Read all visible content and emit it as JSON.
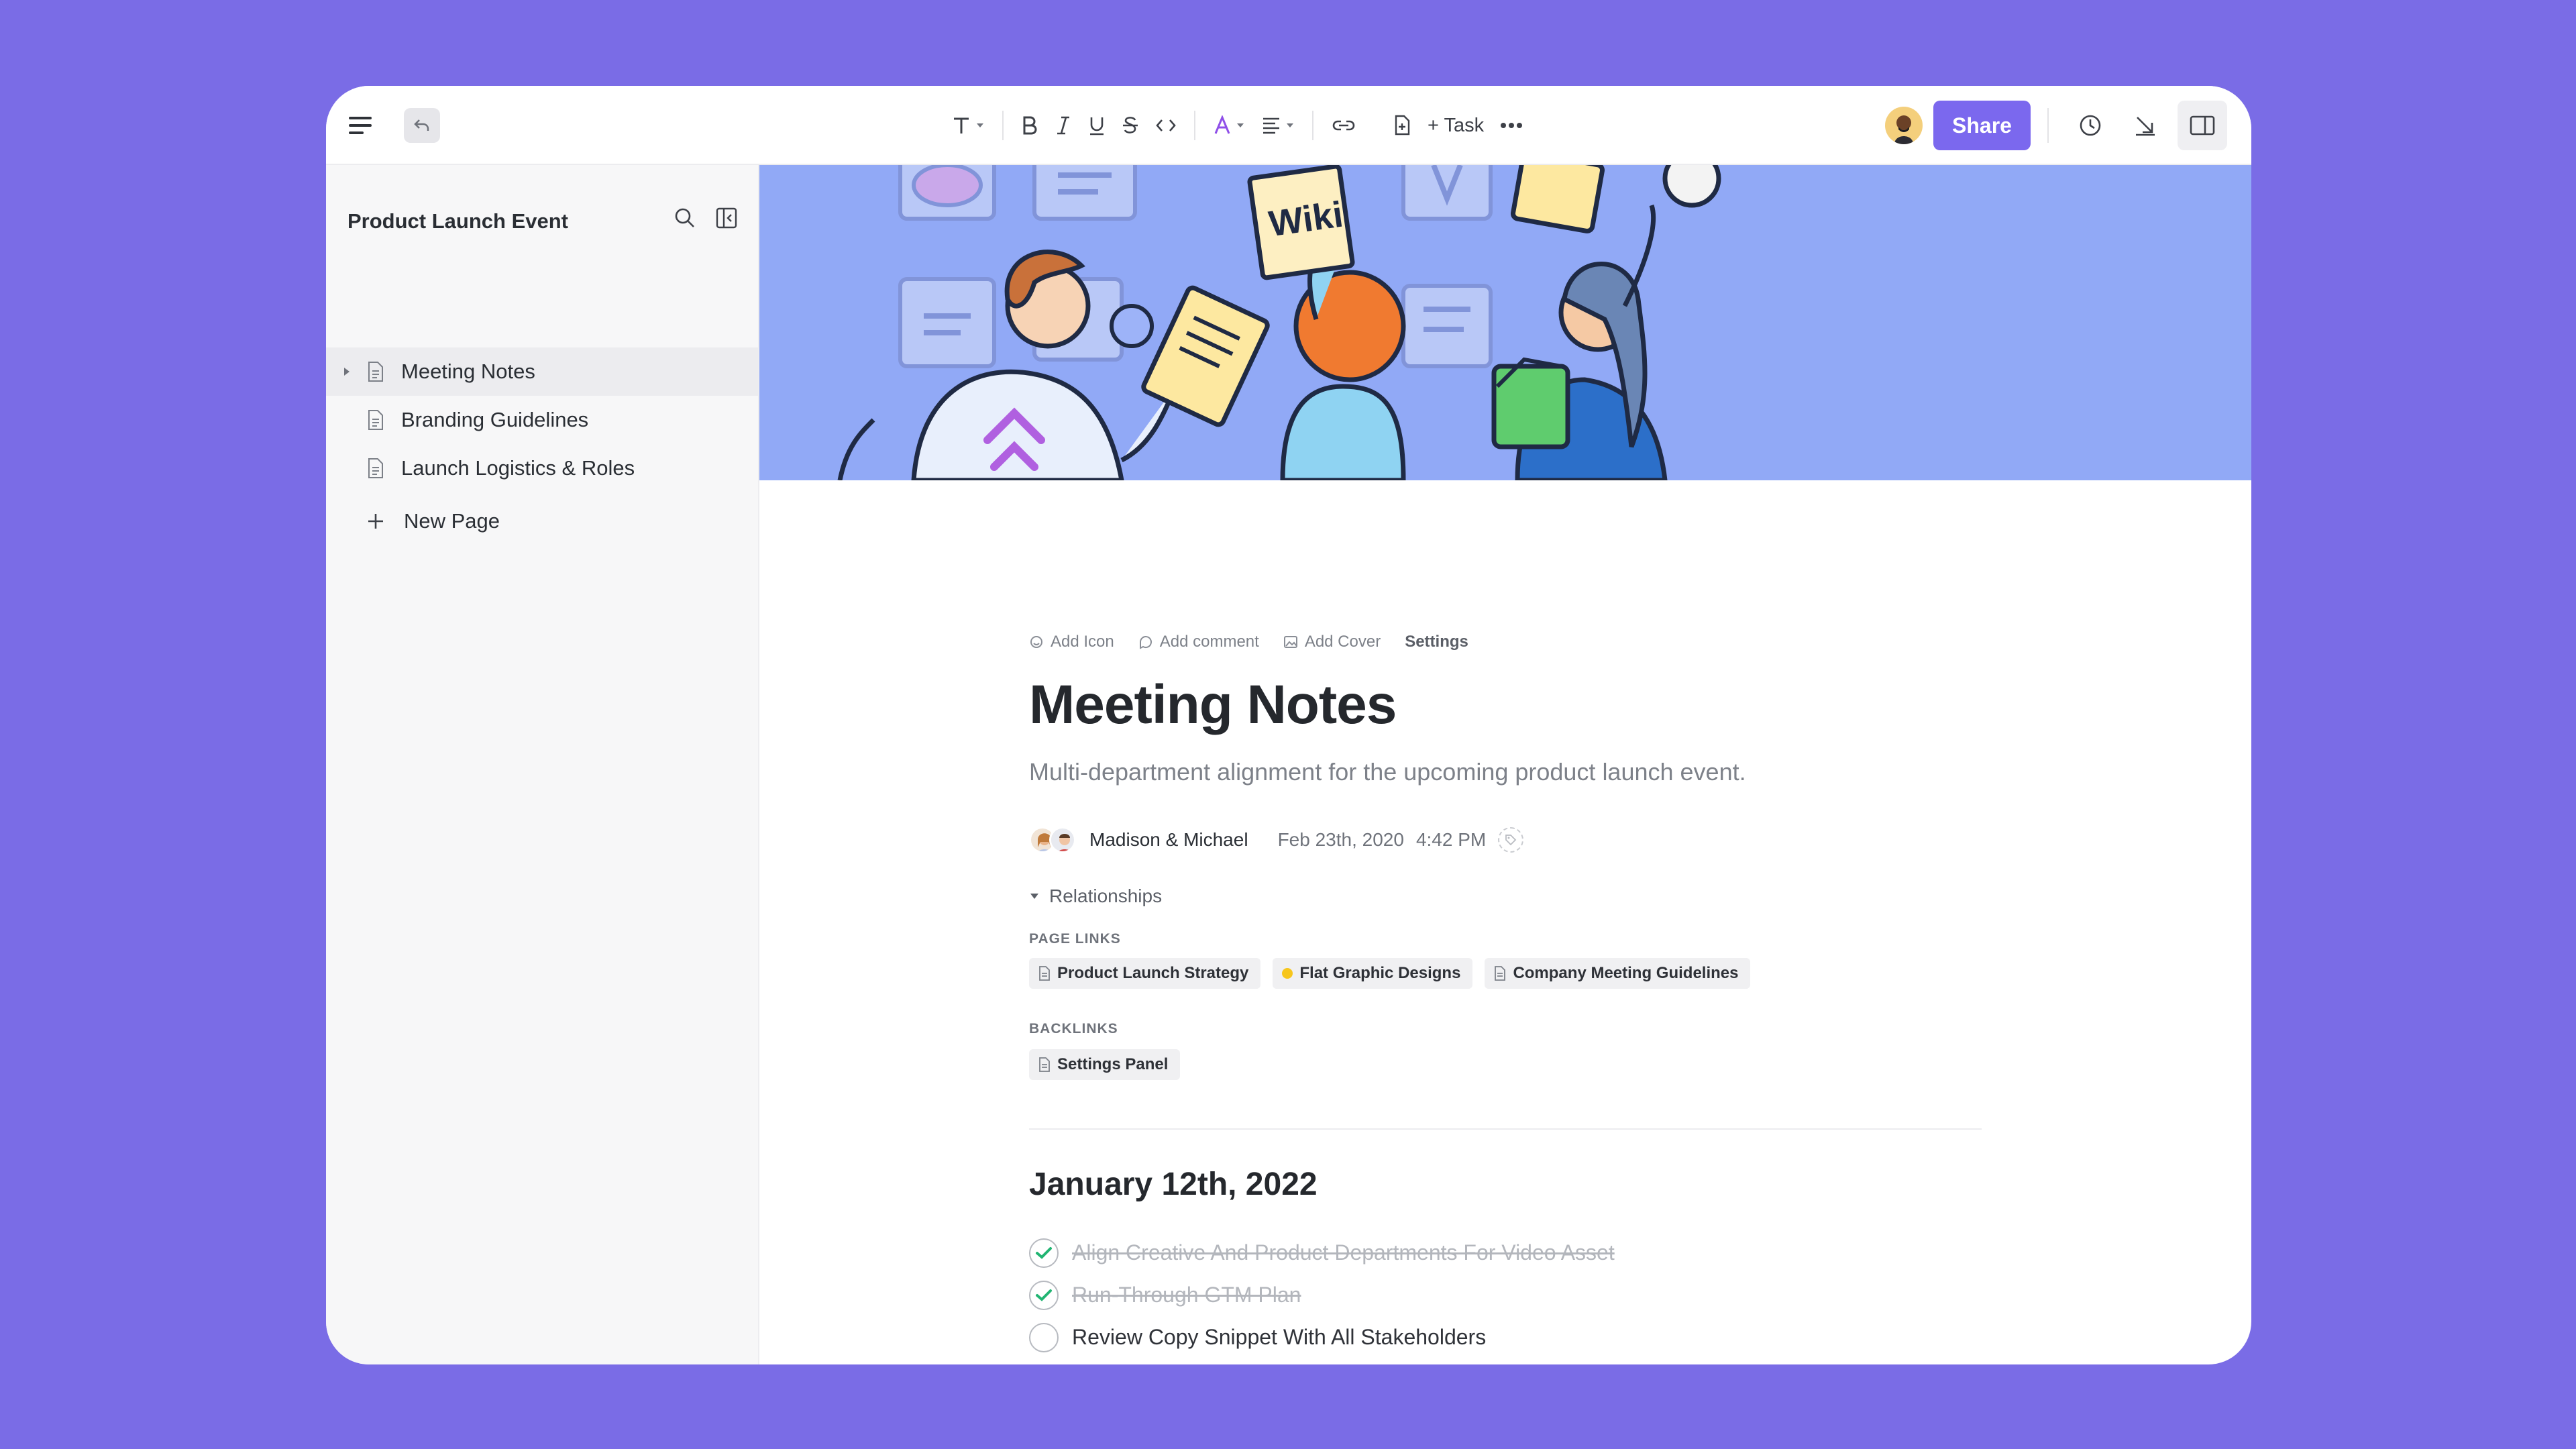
{
  "colors": {
    "background": "#7a6ce6",
    "accent": "#7b68ee",
    "check": "#22b573",
    "cover": "#91a9f6"
  },
  "toolbar": {
    "task_label": "+ Task",
    "share_label": "Share"
  },
  "sidebar": {
    "title": "Product Launch Event",
    "items": [
      {
        "label": "Meeting Notes",
        "active": true
      },
      {
        "label": "Branding Guidelines"
      },
      {
        "label": "Launch Logistics & Roles"
      }
    ],
    "new_page_label": "New Page"
  },
  "cover": {
    "wiki_sign": "Wiki"
  },
  "page": {
    "actions": {
      "add_icon": "Add Icon",
      "add_comment": "Add comment",
      "add_cover": "Add Cover",
      "settings": "Settings"
    },
    "title": "Meeting Notes",
    "subtitle": "Multi-department alignment for the upcoming product launch event.",
    "authors": "Madison & Michael",
    "date": "Feb 23th, 2020",
    "time": "4:42 PM",
    "relationships_label": "Relationships",
    "page_links_label": "PAGE LINKS",
    "page_links": [
      "Product Launch Strategy",
      "Flat Graphic Designs",
      "Company Meeting Guidelines"
    ],
    "backlinks_label": "BACKLINKS",
    "backlinks": [
      "Settings Panel"
    ],
    "section_heading": "January 12th, 2022",
    "todos": [
      {
        "text": "Align Creative And Product Departments For Video Asset",
        "done": true
      },
      {
        "text": "Run-Through GTM Plan",
        "done": true
      },
      {
        "text": "Review Copy Snippet With All Stakeholders",
        "done": false
      }
    ]
  }
}
